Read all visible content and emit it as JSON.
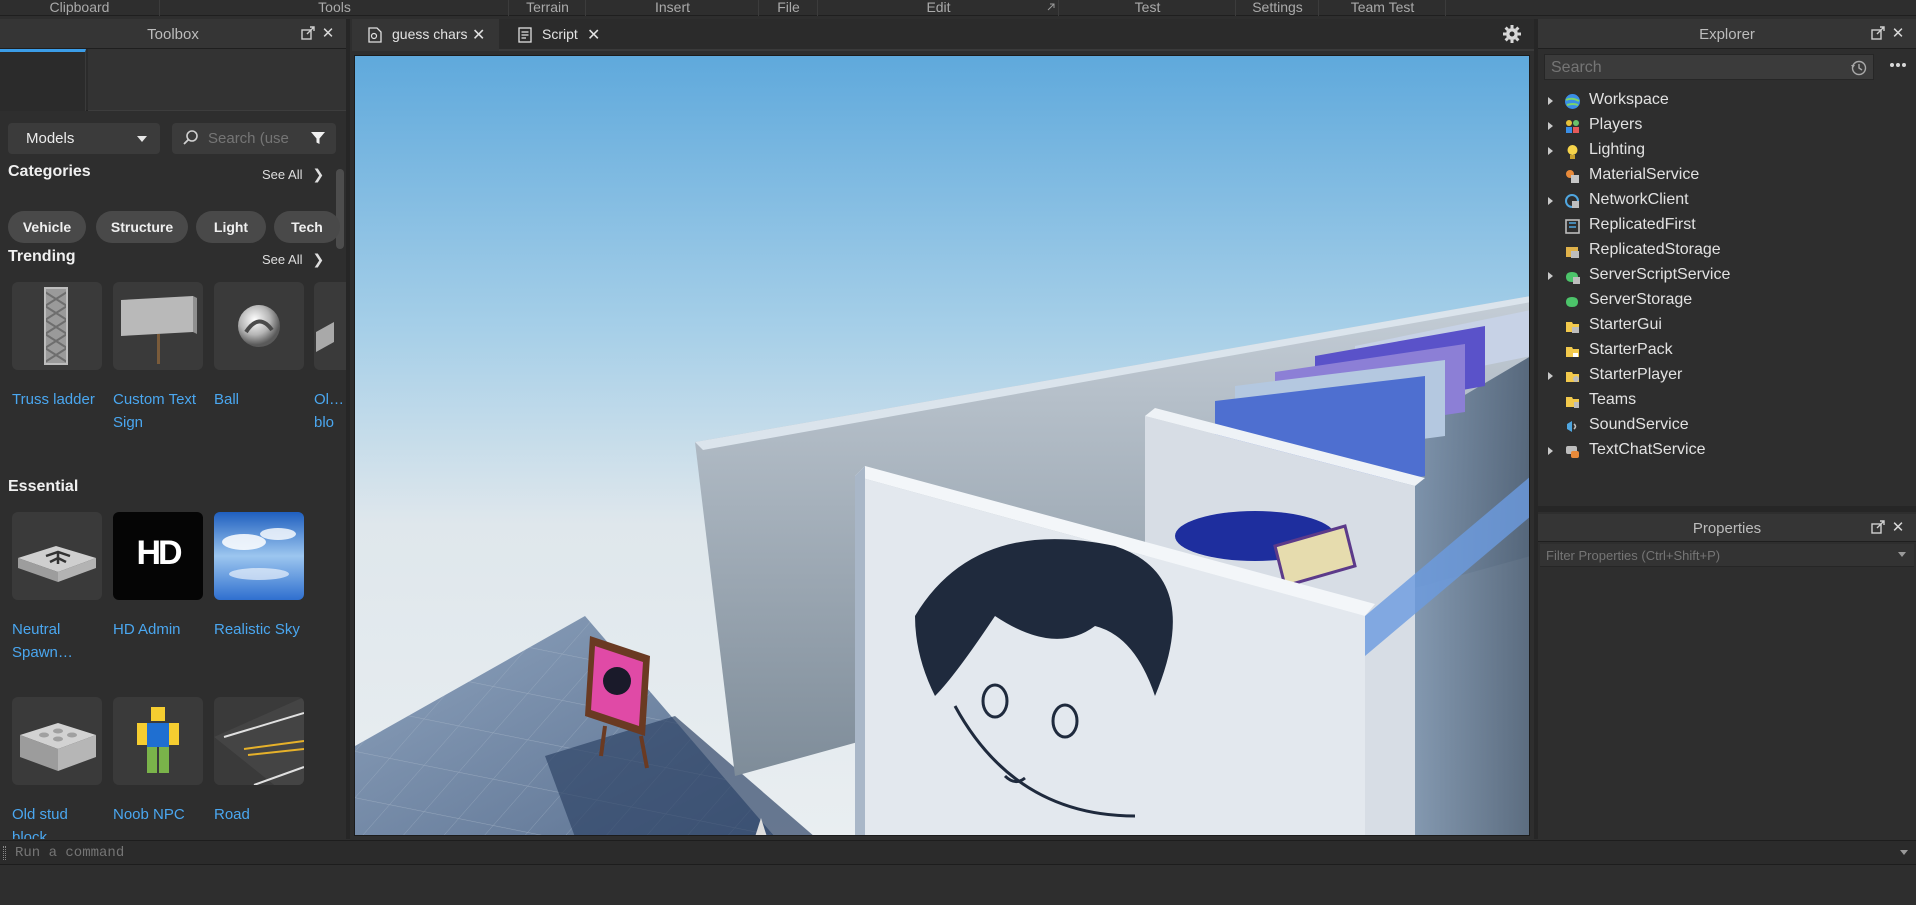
{
  "ribbon": {
    "groups": [
      "Clipboard",
      "Tools",
      "Terrain",
      "Insert",
      "File",
      "Edit",
      "Test",
      "Settings",
      "Team Test"
    ]
  },
  "toolbox": {
    "title": "Toolbox",
    "dropdown_value": "Models",
    "search_placeholder": "Search (use",
    "categories_title": "Categories",
    "see_all": "See All",
    "categories": [
      "Vehicle",
      "Structure",
      "Light",
      "Tech"
    ],
    "trending_title": "Trending",
    "trending": [
      {
        "name": "Truss ladder"
      },
      {
        "name": "Custom Text Sign"
      },
      {
        "name": "Ball"
      },
      {
        "name": "Ol… blo"
      }
    ],
    "essential_title": "Essential",
    "essential": [
      {
        "name": "Neutral Spawn…"
      },
      {
        "name": "HD Admin",
        "logo": "HD"
      },
      {
        "name": "Realistic Sky"
      },
      {
        "name": "Old stud block"
      },
      {
        "name": "Noob NPC"
      },
      {
        "name": "Road"
      }
    ]
  },
  "tabs": [
    {
      "label": "guess chars",
      "active": true
    },
    {
      "label": "Script",
      "active": false
    }
  ],
  "explorer": {
    "title": "Explorer",
    "search_placeholder": "Search",
    "items": [
      {
        "label": "Workspace",
        "expandable": true,
        "icon": "workspace-icon"
      },
      {
        "label": "Players",
        "expandable": true,
        "icon": "players-icon"
      },
      {
        "label": "Lighting",
        "expandable": true,
        "icon": "lighting-icon"
      },
      {
        "label": "MaterialService",
        "expandable": false,
        "icon": "material-service-icon"
      },
      {
        "label": "NetworkClient",
        "expandable": true,
        "icon": "network-client-icon"
      },
      {
        "label": "ReplicatedFirst",
        "expandable": false,
        "icon": "replicated-first-icon"
      },
      {
        "label": "ReplicatedStorage",
        "expandable": false,
        "icon": "replicated-storage-icon"
      },
      {
        "label": "ServerScriptService",
        "expandable": true,
        "icon": "server-script-service-icon"
      },
      {
        "label": "ServerStorage",
        "expandable": false,
        "icon": "server-storage-icon"
      },
      {
        "label": "StarterGui",
        "expandable": false,
        "icon": "starter-gui-icon"
      },
      {
        "label": "StarterPack",
        "expandable": false,
        "icon": "starter-pack-icon"
      },
      {
        "label": "StarterPlayer",
        "expandable": true,
        "icon": "starter-player-icon"
      },
      {
        "label": "Teams",
        "expandable": false,
        "icon": "teams-icon"
      },
      {
        "label": "SoundService",
        "expandable": false,
        "icon": "sound-service-icon"
      },
      {
        "label": "TextChatService",
        "expandable": true,
        "icon": "text-chat-service-icon"
      }
    ]
  },
  "properties": {
    "title": "Properties",
    "filter_placeholder": "Filter Properties (Ctrl+Shift+P)"
  },
  "command_bar": {
    "placeholder": "Run a command"
  },
  "colors": {
    "accent": "#3b9de8",
    "link": "#4aa7f0",
    "panel": "#2e2e2e"
  }
}
